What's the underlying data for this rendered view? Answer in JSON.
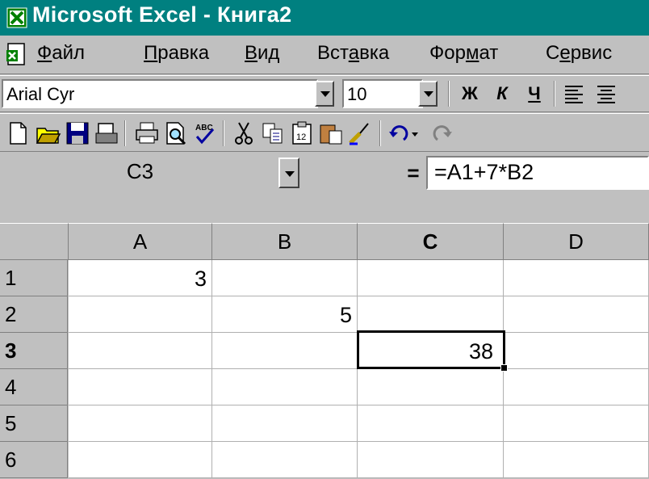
{
  "window": {
    "title": "Microsoft Excel - Книга2"
  },
  "menu": {
    "items": [
      {
        "pre": "",
        "key": "Ф",
        "post": "айл"
      },
      {
        "pre": "",
        "key": "П",
        "post": "равка"
      },
      {
        "pre": "",
        "key": "В",
        "post": "ид"
      },
      {
        "pre": "Вст",
        "key": "а",
        "post": "вка"
      },
      {
        "pre": "Фор",
        "key": "м",
        "post": "ат"
      },
      {
        "pre": "С",
        "key": "е",
        "post": "рвис"
      }
    ]
  },
  "format_toolbar": {
    "font": "Arial Cyr",
    "size": "10",
    "bold": "Ж",
    "italic": "К",
    "underline": "Ч"
  },
  "standard_toolbar": {
    "icons": [
      "new-icon",
      "open-icon",
      "save-icon",
      "mail-icon",
      "print-icon",
      "print-preview-icon",
      "spelling-icon",
      "cut-icon",
      "copy-icon",
      "paste-icon",
      "paste-special-icon",
      "format-painter-icon",
      "undo-icon",
      "redo-icon"
    ]
  },
  "formula_bar": {
    "name_box": "C3",
    "equals": "=",
    "formula": "=A1+7*B2"
  },
  "sheet": {
    "columns": [
      "A",
      "B",
      "C",
      "D"
    ],
    "rows": [
      {
        "label": "1",
        "cells": [
          "3",
          "",
          "",
          ""
        ]
      },
      {
        "label": "2",
        "cells": [
          "",
          "5",
          "",
          ""
        ]
      },
      {
        "label": "3",
        "cells": [
          "",
          "",
          "38",
          ""
        ]
      },
      {
        "label": "4",
        "cells": [
          "",
          "",
          "",
          ""
        ]
      },
      {
        "label": "5",
        "cells": [
          "",
          "",
          "",
          ""
        ]
      },
      {
        "label": "6",
        "cells": [
          "",
          "",
          "",
          ""
        ]
      }
    ],
    "active_cell": "C3",
    "selection_color": "#000000"
  },
  "colors": {
    "title_bar": "#008080",
    "chrome": "#c0c0c0"
  }
}
